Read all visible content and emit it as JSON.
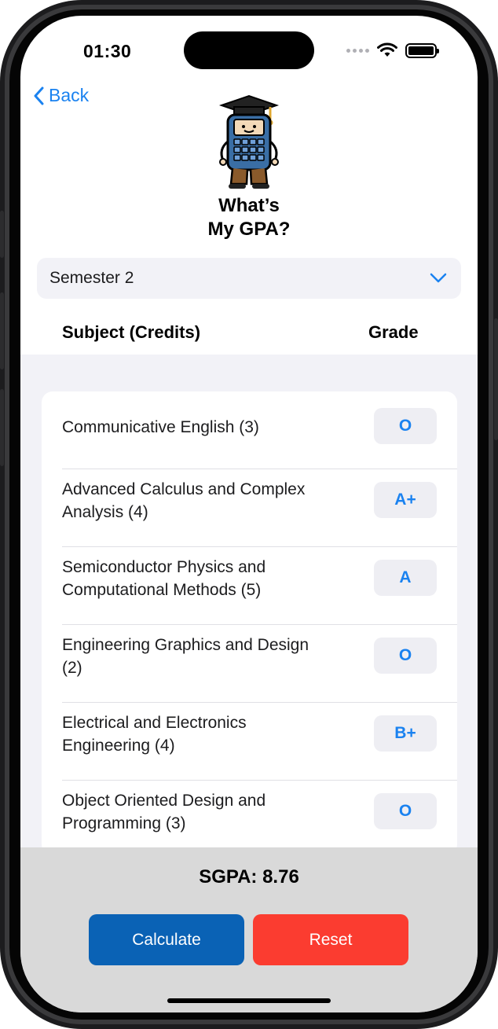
{
  "status_bar": {
    "time": "01:30"
  },
  "nav": {
    "back_label": "Back"
  },
  "app": {
    "title_line1": "What’s",
    "title_line2": "My GPA?"
  },
  "semester_picker": {
    "selected": "Semester 2"
  },
  "columns": {
    "subject": "Subject (Credits)",
    "grade": "Grade"
  },
  "subjects": [
    {
      "name_line1": "Communicative English (3)",
      "name_line2": "",
      "grade": "O"
    },
    {
      "name_line1": "Advanced Calculus and Complex",
      "name_line2": "Analysis (4)",
      "grade": "A+"
    },
    {
      "name_line1": "Semiconductor Physics and",
      "name_line2": "Computational Methods (5)",
      "grade": "A"
    },
    {
      "name_line1": "Engineering Graphics and Design",
      "name_line2": "(2)",
      "grade": "O"
    },
    {
      "name_line1": "Electrical and Electronics",
      "name_line2": "Engineering (4)",
      "grade": "B+"
    },
    {
      "name_line1": "Object Oriented Design and",
      "name_line2": "Programming (3)",
      "grade": "O"
    }
  ],
  "result": {
    "sgpa_text": "SGPA: 8.76"
  },
  "actions": {
    "calculate_label": "Calculate",
    "reset_label": "Reset"
  },
  "colors": {
    "accent": "#1a82f0",
    "calculate": "#0a62b5",
    "reset": "#fb3c30",
    "bottom_bar": "#d9d9d9",
    "list_bg": "#f2f2f7"
  }
}
